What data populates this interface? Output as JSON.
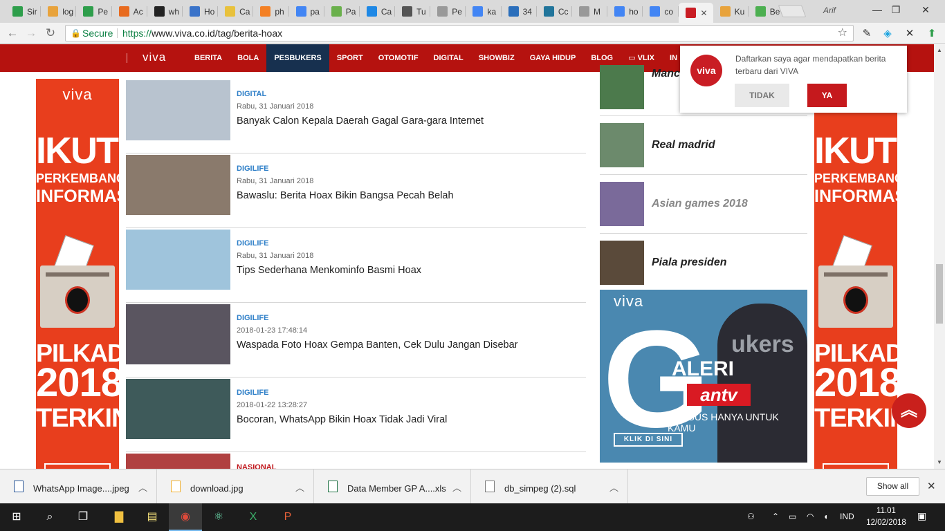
{
  "browser": {
    "tabs": [
      {
        "label": "Sir",
        "icon": "triangle-icon",
        "color": "#2e9e4b"
      },
      {
        "label": "log",
        "icon": "pma-icon",
        "color": "#e8a33c"
      },
      {
        "label": "Pe",
        "icon": "triangle-icon",
        "color": "#2e9e4b"
      },
      {
        "label": "Ac",
        "icon": "box-icon",
        "color": "#e86b1f"
      },
      {
        "label": "wh",
        "icon": "github-icon",
        "color": "#222222"
      },
      {
        "label": "Ho",
        "icon": "page-icon",
        "color": "#3a73c9"
      },
      {
        "label": "Ca",
        "icon": "code-icon",
        "color": "#e8c13c"
      },
      {
        "label": "ph",
        "icon": "stack-icon",
        "color": "#f48024"
      },
      {
        "label": "pa",
        "icon": "google-icon",
        "color": "#4285f4"
      },
      {
        "label": "Pa",
        "icon": "leaf-icon",
        "color": "#6ab04c"
      },
      {
        "label": "Ca",
        "icon": "link-icon",
        "color": "#1e88e5"
      },
      {
        "label": "Tu",
        "icon": "building-icon",
        "color": "#555555"
      },
      {
        "label": "Pe",
        "icon": "doc-icon",
        "color": "#999999"
      },
      {
        "label": "ka",
        "icon": "google-icon",
        "color": "#4285f4"
      },
      {
        "label": "34",
        "icon": "p-icon",
        "color": "#2a6ebb"
      },
      {
        "label": "Cc",
        "icon": "wordpress-icon",
        "color": "#21759b"
      },
      {
        "label": "M",
        "icon": "doc-icon",
        "color": "#999999"
      },
      {
        "label": "ho",
        "icon": "google-icon",
        "color": "#4285f4"
      },
      {
        "label": "co",
        "icon": "google-icon",
        "color": "#4285f4"
      },
      {
        "label": "",
        "icon": "viva-icon",
        "color": "#c91d24",
        "active": true
      },
      {
        "label": "Ku",
        "icon": "rss-icon",
        "color": "#e8a33c"
      },
      {
        "label": "Be",
        "icon": "photo-icon",
        "color": "#4caf50"
      }
    ],
    "close_tab": "✕",
    "user": "Arif",
    "window_buttons": {
      "minimize": "—",
      "maximize": "❐",
      "close": "✕"
    },
    "secure_label": "Secure",
    "url_scheme": "https://",
    "url_rest": "www.viva.co.id/tag/berita-hoax"
  },
  "site": {
    "logo": "viva",
    "nav": [
      "BERITA",
      "BOLA",
      "PESBUKERS",
      "SPORT",
      "OTOMOTIF",
      "DIGITAL",
      "SHOWBIZ",
      "GAYA HIDUP",
      "BLOG",
      "VLIX",
      "IN"
    ],
    "active_nav": "PESBUKERS",
    "banner": {
      "logo": "viva",
      "line1": "IKUTI",
      "line2": "PERKEMBANGAN",
      "line3": "INFORMASI",
      "line4": "PILKADA",
      "line5": "2018",
      "line6": "TERKINI"
    },
    "articles": [
      {
        "category": "DIGITAL",
        "date": "Rabu, 31 Januari 2018",
        "title": "Banyak Calon Kepala Daerah Gagal Gara-gara Internet",
        "thumb": "#b8c3cf"
      },
      {
        "category": "DIGILIFE",
        "date": "Rabu, 31 Januari 2018",
        "title": "Bawaslu: Berita Hoax Bikin Bangsa Pecah Belah",
        "thumb": "#8a7a6c"
      },
      {
        "category": "DIGILIFE",
        "date": "Rabu, 31 Januari 2018",
        "title": "Tips Sederhana Menkominfo Basmi Hoax",
        "thumb": "#9fc4dc"
      },
      {
        "category": "DIGILIFE",
        "date": "2018-01-23 17:48:14",
        "title": "Waspada Foto Hoax Gempa Banten, Cek Dulu Jangan Disebar",
        "thumb": "#5a5560"
      },
      {
        "category": "DIGILIFE",
        "date": "2018-01-22 13:28:27",
        "title": "Bocoran, WhatsApp Bikin Hoax Tidak Jadi Viral",
        "thumb": "#3e5a5a"
      },
      {
        "category": "NASIONAL",
        "date": "",
        "title": "",
        "thumb": "#b04040"
      }
    ],
    "topics": [
      {
        "name": "Manc",
        "thumb": "#4c7a4c",
        "dim": false
      },
      {
        "name": "Real madrid",
        "thumb": "#6c8a6c",
        "dim": false
      },
      {
        "name": "Asian games 2018",
        "thumb": "#7a6a9a",
        "dim": true
      },
      {
        "name": "Piala presiden",
        "thumb": "#5a4a3a",
        "dim": false
      }
    ],
    "galeri": {
      "viva": "viva",
      "big_letter": "G",
      "rest": "ALERI",
      "antv": "antv",
      "tagline": "KHUSUS HANYA UNTUK KAMU",
      "cta": "KLIK DI SINI",
      "bg_word": "ukers"
    },
    "push": {
      "icon_text": "viva",
      "message": "Daftarkan saya agar mendapatkan berita terbaru dari VIVA",
      "deny": "TIDAK",
      "accept": "YA"
    },
    "to_top": "︽"
  },
  "downloads": {
    "items": [
      {
        "name": "WhatsApp Image....jpeg"
      },
      {
        "name": "download.jpg"
      },
      {
        "name": "Data Member GP A....xls"
      },
      {
        "name": "db_simpeg (2).sql"
      }
    ],
    "chevron": "︿",
    "show_all": "Show all",
    "close": "✕"
  },
  "taskbar": {
    "lang": "IND",
    "time": "11.01",
    "date": "12/02/2018"
  }
}
